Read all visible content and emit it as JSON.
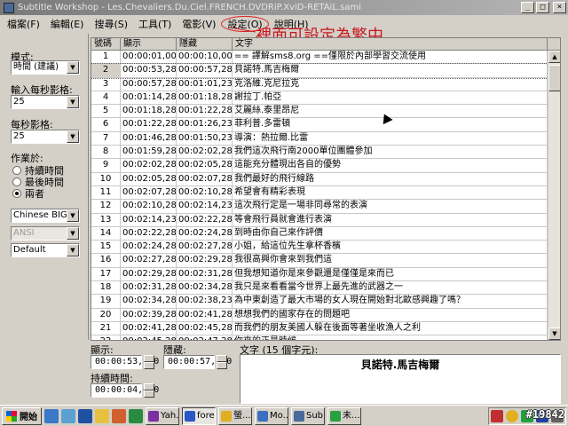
{
  "window": {
    "title": "Subtitle Workshop - Les.Chevaliers.Du.Ciel.FRENCH.DVDRiP.XviD-RETAiL.sami"
  },
  "menu": [
    "檔案(F)",
    "編輯(E)",
    "搜尋(S)",
    "工具(T)",
    "電影(V)",
    "設定(O)",
    "說明(H)"
  ],
  "annotation": "裡面可設定為繁中",
  "left": {
    "mode_label": "模式:",
    "mode_value": "時間 (建議)",
    "fps_input_label": "輸入每秒影格:",
    "fps_input_value": "25",
    "fps_label": "每秒影格:",
    "fps_value": "25",
    "workon_label": "作業於:",
    "radios": [
      {
        "label": "持續時間",
        "checked": false
      },
      {
        "label": "最後時間",
        "checked": false
      },
      {
        "label": "兩者",
        "checked": true
      }
    ],
    "charset1": "Chinese BIG5",
    "charset2": "ANSI",
    "charset3": "Default"
  },
  "grid": {
    "headers": [
      "號碼",
      "顯示",
      "隱藏",
      "文字"
    ],
    "rows": [
      [
        "1",
        "00:00:01,000",
        "00:00:10,000",
        "== 譯解sms8.org ==僅限於內部學習交流使用"
      ],
      [
        "2",
        "00:00:53,280",
        "00:00:57,280",
        "貝諾特.馬吉梅爾"
      ],
      [
        "3",
        "00:00:57,280",
        "00:01:01,239",
        "克洛維.克尼拉克"
      ],
      [
        "4",
        "00:01:14,280",
        "00:01:18,280",
        "謝拉丁.帕亞"
      ],
      [
        "5",
        "00:01:18,280",
        "00:01:22,280",
        "艾麗絲.泰里昂尼"
      ],
      [
        "6",
        "00:01:22,280",
        "00:01:26,239",
        "菲利普.多雷頓"
      ],
      [
        "7",
        "00:01:46,280",
        "00:01:50,239",
        "導演：熱拉爾.比雷"
      ],
      [
        "8",
        "00:01:59,280",
        "00:02:02,280",
        "我們這次飛行南2000單位團體參加"
      ],
      [
        "9",
        "00:02:02,280",
        "00:02:05,280",
        "這能充分體現出各自的優勢"
      ],
      [
        "10",
        "00:02:05,280",
        "00:02:07,280",
        "我們最好的飛行線路"
      ],
      [
        "11",
        "00:02:07,280",
        "00:02:10,280",
        "希望會有精彩表現"
      ],
      [
        "12",
        "00:02:10,280",
        "00:02:14,239",
        "這次飛行定是一場非同尋常的表演"
      ],
      [
        "13",
        "00:02:14,239",
        "00:02:22,280",
        "等會飛行員就會進行表演"
      ],
      [
        "14",
        "00:02:22,280",
        "00:02:24,280",
        "到時由你自己來作評價"
      ],
      [
        "15",
        "00:02:24,280",
        "00:02:27,280",
        "小姐，給這位先生拿杯香檳"
      ],
      [
        "16",
        "00:02:27,280",
        "00:02:29,280",
        "我很高興你會來到我們這"
      ],
      [
        "17",
        "00:02:29,280",
        "00:02:31,280",
        "但我想知道你是來參觀還是僅僅是來而已"
      ],
      [
        "18",
        "00:02:31,280",
        "00:02:34,280",
        "我只是來看看當今世界上最先進的武器之一"
      ],
      [
        "19",
        "00:02:34,280",
        "00:02:38,239",
        "為中東創造了最大市場的女人現在開始對北歐感興趣了嗎？"
      ],
      [
        "20",
        "00:02:39,280",
        "00:02:41,280",
        "想想我們的國家存在的問題吧"
      ],
      [
        "21",
        "00:02:41,280",
        "00:02:45,280",
        "而我們的朋友美國人躲在後面等著坐收漁人之利"
      ],
      [
        "22",
        "00:02:45,280",
        "00:02:47,280",
        "你來的正是時候"
      ],
      [
        "23",
        "00:02:47,280",
        "00:02:51,280",
        "你可以要看你的國家內作商業預約"
      ]
    ],
    "selected_index": 1
  },
  "bottom": {
    "show_label": "顯示:",
    "show_value": "00:00:53,280",
    "hide_label": "隱藏:",
    "hide_value": "00:00:57,280",
    "duration_label": "持續時間:",
    "duration_value": "00:00:04,000",
    "text_label": "文字 (15 個字元):",
    "text_value": "貝諾特.馬吉梅爾"
  },
  "taskbar": {
    "start": "開始",
    "tasks": [
      {
        "label": "Yah...",
        "color": "#7b2fa0"
      },
      {
        "label": "fore...",
        "color": "#2b57c8",
        "active": true
      },
      {
        "label": "螢...",
        "color": "#e0b020"
      },
      {
        "label": "Mo...",
        "color": "#3a6ec0"
      },
      {
        "label": "Sub...",
        "color": "#4a6a9a"
      },
      {
        "label": "未...",
        "color": "#2aa040"
      }
    ],
    "tray_lang": "En"
  },
  "watermark": "#19842"
}
